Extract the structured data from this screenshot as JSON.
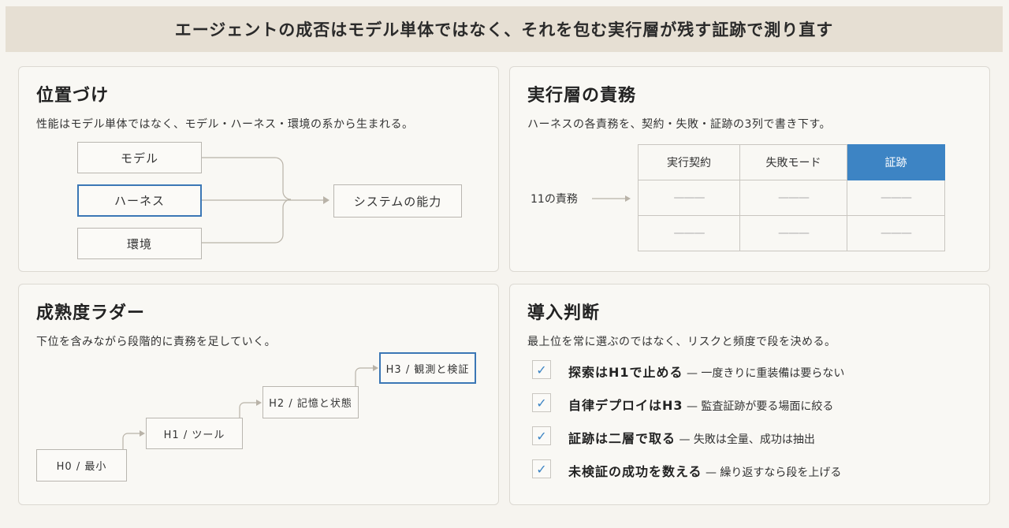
{
  "banner": {
    "title": "エージェントの成否はモデル単体ではなく、それを包む実行層が残す証跡で測り直す"
  },
  "positioning": {
    "title": "位置づけ",
    "subtitle": "性能はモデル単体ではなく、モデル・ハーネス・環境の系から生まれる。",
    "inputs": [
      "モデル",
      "ハーネス",
      "環境"
    ],
    "highlighted": "ハーネス",
    "output": "システムの能力"
  },
  "duties": {
    "title": "実行層の責務",
    "subtitle": "ハーネスの各責務を、契約・失敗・証跡の3列で書き下す。",
    "row_label": "11の責務",
    "columns": [
      "実行契約",
      "失敗モード",
      "証跡"
    ],
    "highlighted_column": "証跡",
    "cell_placeholder": "———",
    "rows": 2
  },
  "ladder": {
    "title": "成熟度ラダー",
    "subtitle": "下位を含みながら段階的に責務を足していく。",
    "steps": [
      "H0 / 最小",
      "H1 / ツール",
      "H2 / 記憶と状態",
      "H3 / 観測と検証"
    ],
    "highlighted": "H3 / 観測と検証"
  },
  "adoption": {
    "title": "導入判断",
    "subtitle": "最上位を常に選ぶのではなく、リスクと頻度で段を決める。",
    "items": [
      {
        "checked": true,
        "bold": "探索はH1で止める",
        "rest": " — 一度きりに重装備は要らない"
      },
      {
        "checked": true,
        "bold": "自律デプロイはH3",
        "rest": " — 監査証跡が要る場面に絞る"
      },
      {
        "checked": true,
        "bold": "証跡は二層で取る",
        "rest": " — 失敗は全量、成功は抽出"
      },
      {
        "checked": true,
        "bold": "未検証の成功を数える",
        "rest": " — 繰り返すなら段を上げる"
      }
    ]
  },
  "colors": {
    "accent": "#3d84c4",
    "banner_bg": "#e6dfd3",
    "arrow": "#b9b3a8"
  }
}
